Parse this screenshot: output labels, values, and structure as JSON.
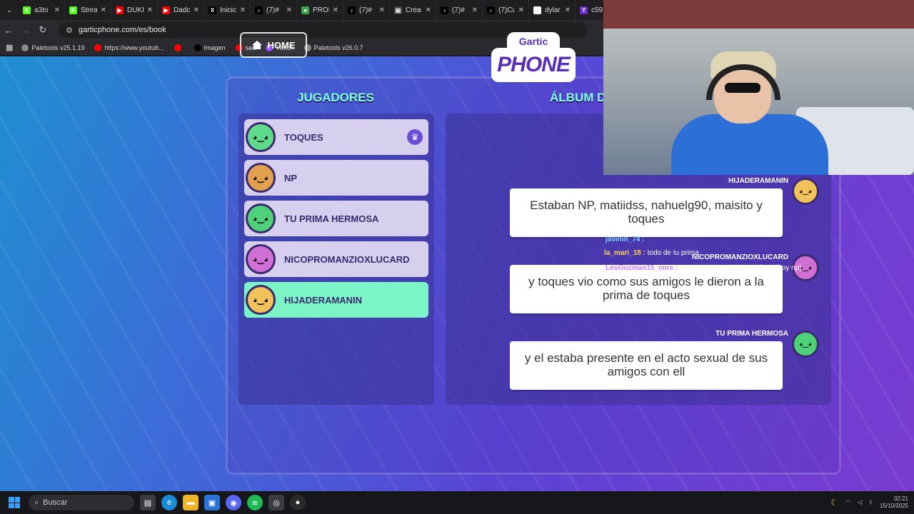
{
  "browser": {
    "tabs": [
      {
        "title": "a3to",
        "color": "#53fc18",
        "glyph": "K"
      },
      {
        "title": "Strea",
        "color": "#53fc18",
        "glyph": "K"
      },
      {
        "title": "DUKI",
        "color": "#ff0000",
        "glyph": "▶"
      },
      {
        "title": "Dadc",
        "color": "#ff0000",
        "glyph": "▶"
      },
      {
        "title": "Inicic",
        "color": "#000000",
        "glyph": "X"
      },
      {
        "title": "(7)#",
        "color": "#000000",
        "glyph": "♪"
      },
      {
        "title": "PRO!",
        "color": "#3fa34d",
        "glyph": "●"
      },
      {
        "title": "(7)#",
        "color": "#000000",
        "glyph": "♪"
      },
      {
        "title": "Crea",
        "color": "#444444",
        "glyph": "▤"
      },
      {
        "title": "(7)#",
        "color": "#000000",
        "glyph": "♪"
      },
      {
        "title": "(7)Cu",
        "color": "#000000",
        "glyph": "♪"
      },
      {
        "title": "dylar",
        "color": "#ffffff",
        "glyph": "G"
      },
      {
        "title": "c59",
        "color": "#6b2fc7",
        "glyph": "Y"
      }
    ],
    "url": "garticphone.com/es/book",
    "bookmarks": [
      {
        "label": "Paletools v25.1.19",
        "color": "#888888"
      },
      {
        "label": "https://www.youtub...",
        "color": "#ff0000"
      },
      {
        "label": "",
        "color": "#ff0000"
      },
      {
        "label": "Imagen",
        "color": "#000000"
      },
      {
        "label": "sad",
        "color": "#ff0000"
      },
      {
        "label": "Twitch",
        "color": "#9146ff"
      },
      {
        "label": "Paletools v26.0.7",
        "color": "#888888"
      }
    ]
  },
  "game": {
    "home_label": "HOME",
    "logo_top": "Gartic",
    "logo_bottom": "PHONE",
    "players_heading": "JUGADORES",
    "album_heading": "ÁLBUM D",
    "players": [
      {
        "name": "TOQUES",
        "avatar_color": "#5fd98a",
        "host": true,
        "active": false
      },
      {
        "name": "NP",
        "avatar_color": "#e3a04f",
        "host": false,
        "active": false
      },
      {
        "name": "TU PRIMA HERMOSA",
        "avatar_color": "#4fd17a",
        "host": false,
        "active": false
      },
      {
        "name": "NICOPROMANZIOXLUCARD",
        "avatar_color": "#d06fd6",
        "host": false,
        "active": false
      },
      {
        "name": "HIJADERAMANIN",
        "avatar_color": "#f1c15a",
        "host": false,
        "active": true
      }
    ],
    "album": [
      {
        "author": "HIJADERAMANIN",
        "text": "Estaban NP, matiidss, nahuelg90, maisito y toques",
        "avatar_color": "#f1c15a"
      },
      {
        "author": "NICOPROMANZIOXLUCARD",
        "text": "y toques vio como sus amigos le dieron a la prima de toques",
        "avatar_color": "#d06fd6"
      },
      {
        "author": "TU PRIMA HERMOSA",
        "text": "y el estaba presente en el acto sexual de sus amigos con ell",
        "avatar_color": "#4fd17a"
      }
    ]
  },
  "chat": [
    {
      "user": "javinin_74 :",
      "message": "",
      "user_color": "#7bd4ff"
    },
    {
      "user": "la_mari_18 :",
      "message": "todo de tu prima",
      "user_color": "#ffd54a"
    },
    {
      "user": "LeoGuzman15_imre :",
      "message": "tan buena esta la prima chat? (soy np)",
      "user_color": "#c77dff"
    }
  ],
  "taskbar": {
    "search_placeholder": "Buscar",
    "time": "02:21",
    "date": "15/10/2025"
  }
}
